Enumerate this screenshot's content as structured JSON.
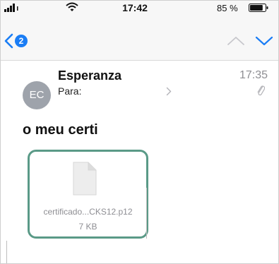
{
  "status_bar": {
    "time": "17:42",
    "battery_percent": "85 %",
    "battery_level": 0.85
  },
  "nav": {
    "back_badge": "2",
    "icons": [
      "chevron-left-icon",
      "chevron-up-icon",
      "chevron-down-icon"
    ],
    "accent_color": "#1a7df5"
  },
  "message": {
    "avatar_initials": "EC",
    "sender": "Esperanza",
    "to_label": "Para:",
    "time": "17:35",
    "subject": "o meu certi"
  },
  "attachment": {
    "file_name": "certificado...CKS12.p12",
    "file_size": "7 KB",
    "highlight_color": "#5a9a87"
  }
}
